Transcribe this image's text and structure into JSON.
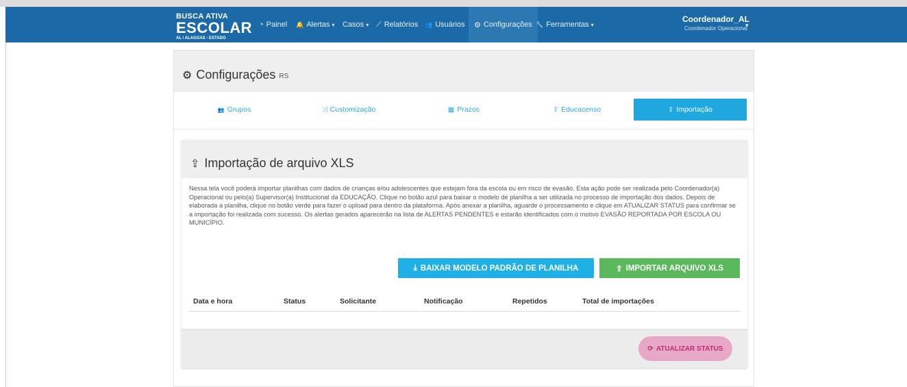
{
  "brand": {
    "top": "BUSCA ATIVA",
    "main": "ESCOLAR",
    "sub": "AL / ALAGOAS - ESTADO"
  },
  "nav": {
    "items": [
      {
        "label": "Painel",
        "icon": "dashboard-icon",
        "glyph": "◔"
      },
      {
        "label": "Alertas",
        "icon": "bell-icon",
        "glyph": "🔔",
        "caret": "▾"
      },
      {
        "label": "Casos",
        "icon": "",
        "glyph": "",
        "caret": "▾"
      },
      {
        "label": "Relatórios",
        "icon": "line-chart-icon",
        "glyph": "⟋"
      },
      {
        "label": "Usuários",
        "icon": "users-icon",
        "glyph": "👥"
      },
      {
        "label": "Configurações",
        "icon": "gear-icon",
        "glyph": "⚙"
      },
      {
        "label": "Ferramentas",
        "icon": "wrench-icon",
        "glyph": "🔧",
        "caret": "▾"
      }
    ],
    "active": "Configurações"
  },
  "user": {
    "name": "Coordenador_AL",
    "role": "Coordenador Operacional",
    "caret": "▾"
  },
  "page": {
    "title": "Configurações",
    "subtitle": "RS",
    "title_icon": "gear-icon"
  },
  "tabs": [
    {
      "label": "Grupos",
      "icon": "users-icon",
      "glyph": "👥"
    },
    {
      "label": "Customização",
      "icon": "shuffle-icon",
      "glyph": "⤨"
    },
    {
      "label": "Prazos",
      "icon": "calendar-icon",
      "glyph": "▦"
    },
    {
      "label": "Educacenso",
      "icon": "upload-icon",
      "glyph": "⇪"
    },
    {
      "label": "Importação",
      "icon": "upload-icon",
      "glyph": "⇪"
    }
  ],
  "active_tab": "Importação",
  "import": {
    "title": "Importação de arquivo XLS",
    "title_icon": "upload-icon",
    "description": "Nessa tela você poderá importar planilhas com dados de crianças e/ou adolescentes que estejam fora da escola ou em risco de evasão. Esta ação pode ser realizada pelo Coordenador(a) Operacional ou pelo(a) Supervisor(a) Institucional da EDUCAÇÃO. Clique no botão azul para baixar o modelo de planilha a ser utilizada no processo de importação dos dados. Depois de elaborada a planilha, clique no botão verde para fazer o upload para dentro da plataforma. Após anexar a planilha, aguarde o processamento e clique em ATUALIZAR STATUS para confirmar se a importação foi realizada com sucesso. Os alertas gerados aparecerão na lista de ALERTAS PENDENTES e estarão identificados com o motivo EVASÃO REPORTADA POR ESCOLA OU MUNICÍPIO.",
    "download_button": "BAIXAR MODELO PADRÃO DE PLANILHA",
    "upload_button": "IMPORTAR ARQUIVO XLS",
    "table_headers": [
      "Data e hora",
      "Status",
      "Solicitante",
      "Notificação",
      "Repetidos",
      "Total de importações"
    ],
    "refresh_button": "ATUALIZAR STATUS"
  },
  "colors": {
    "navbar": "#1b6aa7",
    "tab_active": "#1fa8e0",
    "blue_button": "#1fb0e6",
    "green_button": "#5cb85c",
    "pink_button": "#e7a8c8"
  }
}
